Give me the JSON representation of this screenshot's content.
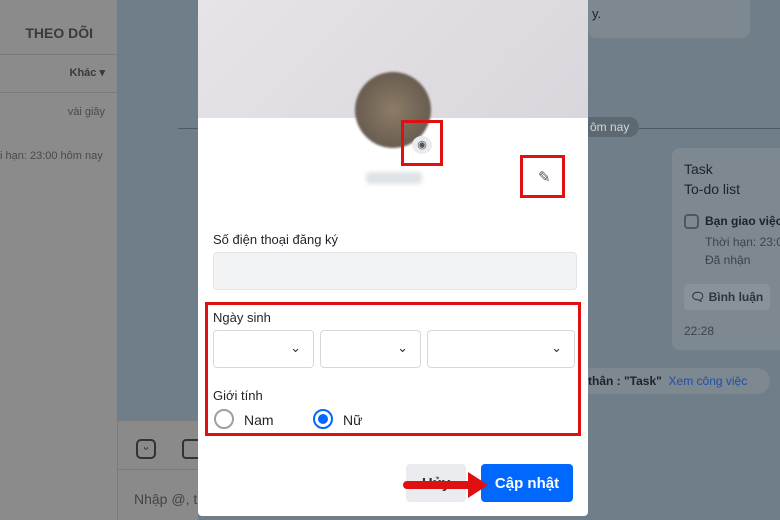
{
  "sidebar": {
    "follow_tab": "THEO DÕI",
    "filter": "Khác",
    "time": "vài giây",
    "deadline": "i hạn: 23:00 hôm nay"
  },
  "chat": {
    "top_message": "y.",
    "date_divider": "ôm nay",
    "task_card": {
      "title": "Task",
      "subtitle": "To-do list",
      "item": "Bạn giao việc",
      "deadline": "Thời hạn: 23:0",
      "status": "Đã nhận",
      "comment_button": "Bình luận",
      "time": "22:28"
    },
    "notice": "thân : \"Task\"",
    "notice_link": "Xem công việc",
    "input_placeholder": "Nhập @, t"
  },
  "modal": {
    "phone_label": "Số điện thoại đăng ký",
    "phone_value": "",
    "birthday_label": "Ngày sinh",
    "day": "",
    "month": "",
    "year": "",
    "gender_label": "Giới tính",
    "gender_options": [
      "Nam",
      "Nữ"
    ],
    "gender_selected": "Nữ",
    "cancel_button": "Hủy",
    "update_button": "Cập nhật"
  },
  "colors": {
    "accent": "#0068ff",
    "highlight": "#e01010"
  }
}
